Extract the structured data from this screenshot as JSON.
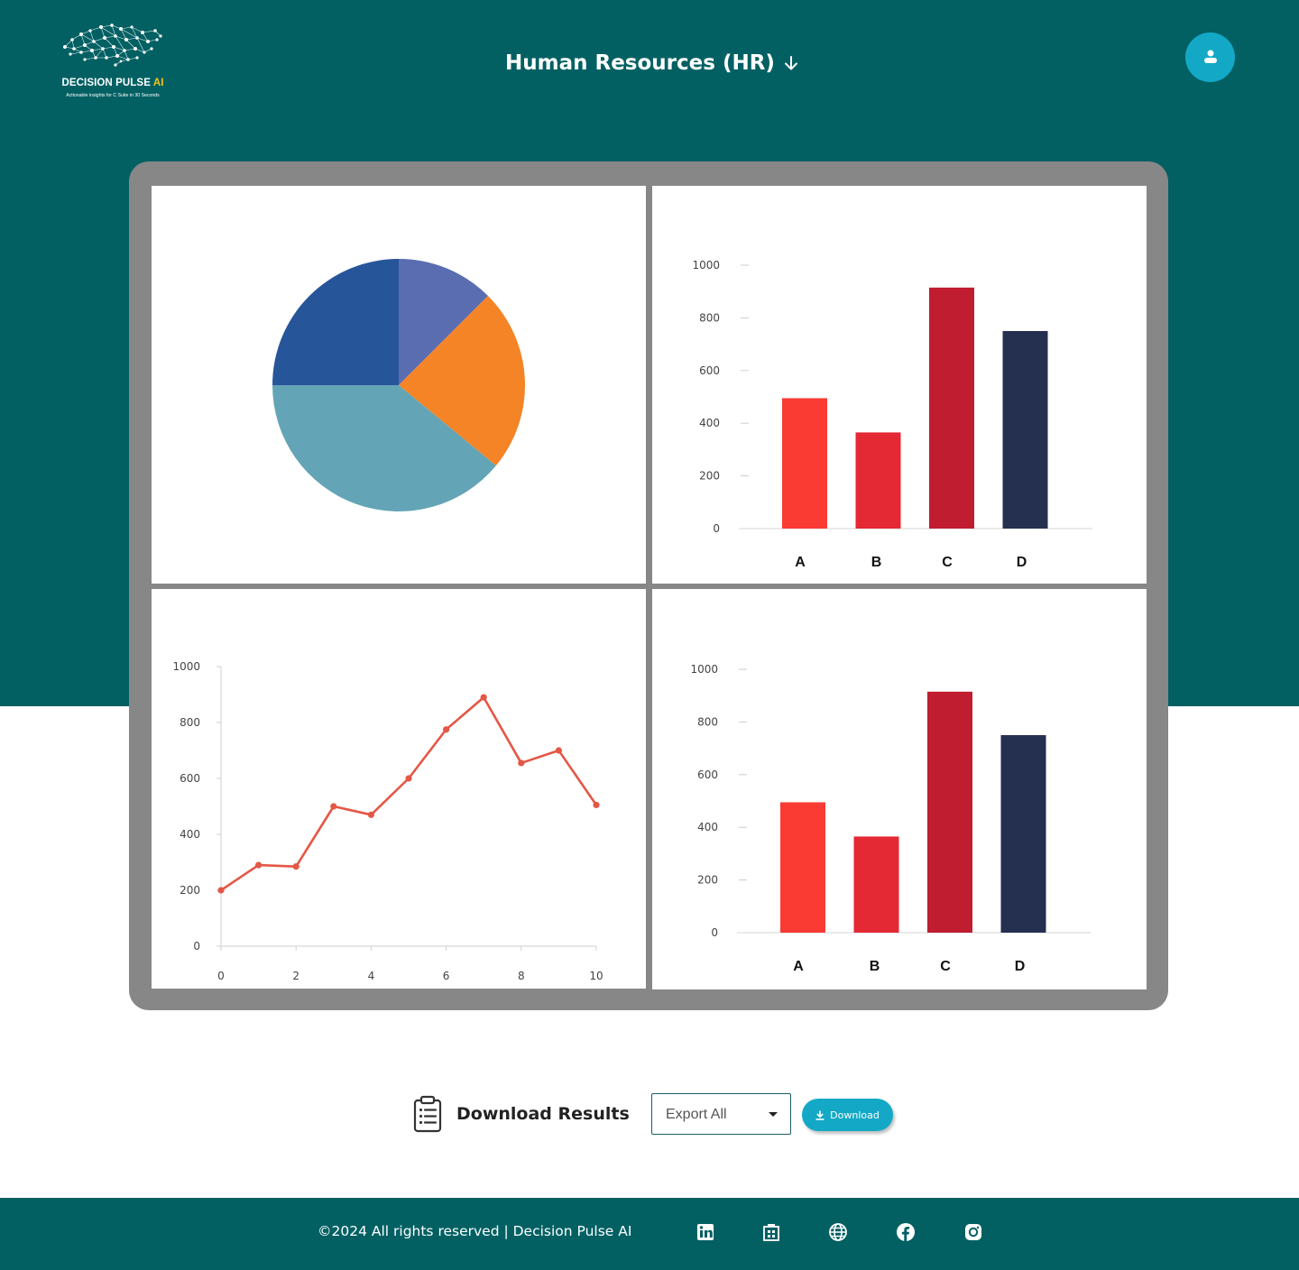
{
  "brand": {
    "name_main": "DECISION PULSE ",
    "name_accent": "AI",
    "tagline": "Actionable insights for C Suite in 30 Seconds",
    "logo_icon": "network-map-logo",
    "accent_color": "#f5c518"
  },
  "header": {
    "department": "Human Resources (HR)",
    "dropdown_icon": "arrow-down-icon",
    "avatar_icon": "user-icon",
    "background_color": "#026063"
  },
  "chart_data": [
    {
      "type": "pie",
      "slices": [
        {
          "value": 12.5,
          "color": "#5a6db1"
        },
        {
          "value": 23.5,
          "color": "#f58426"
        },
        {
          "value": 39,
          "color": "#63a5b6"
        },
        {
          "value": 25,
          "color": "#27559a"
        }
      ]
    },
    {
      "type": "bar",
      "categories": [
        "A",
        "B",
        "C",
        "D"
      ],
      "values": [
        495,
        365,
        915,
        750
      ],
      "colors": [
        "#f93b34",
        "#e42834",
        "#c01d30",
        "#252f50"
      ],
      "y_ticks": [
        "0",
        "200",
        "400",
        "600",
        "800",
        "1000"
      ],
      "ylim": [
        0,
        1000
      ]
    },
    {
      "type": "line",
      "x": [
        0,
        1,
        2,
        3,
        4,
        5,
        6,
        7,
        8,
        9,
        10
      ],
      "y": [
        200,
        290,
        285,
        500,
        470,
        600,
        775,
        890,
        655,
        700,
        505
      ],
      "color": "#e45745",
      "x_ticks": [
        "0",
        "2",
        "4",
        "6",
        "8",
        "10"
      ],
      "y_ticks": [
        "0",
        "200",
        "400",
        "600",
        "800",
        "1000"
      ],
      "xlim": [
        0,
        10
      ],
      "ylim": [
        0,
        1000
      ]
    },
    {
      "type": "bar",
      "categories": [
        "A",
        "B",
        "C",
        "D"
      ],
      "values": [
        495,
        365,
        915,
        750
      ],
      "colors": [
        "#f93b34",
        "#e42834",
        "#c01d30",
        "#252f50"
      ],
      "y_ticks": [
        "0",
        "200",
        "400",
        "600",
        "800",
        "1000"
      ],
      "ylim": [
        0,
        1000
      ]
    }
  ],
  "download": {
    "title": "Download Results",
    "title_icon": "clipboard-list-icon",
    "export_selected": "Export All",
    "button_label": "Download",
    "button_icon": "download-icon",
    "button_color": "#13a9c6"
  },
  "footer": {
    "copyright": "©2024 All rights reserved | Decision Pulse AI",
    "social_icons": [
      "linkedin-icon",
      "building-icon",
      "globe-icon",
      "facebook-icon",
      "instagram-icon"
    ]
  }
}
